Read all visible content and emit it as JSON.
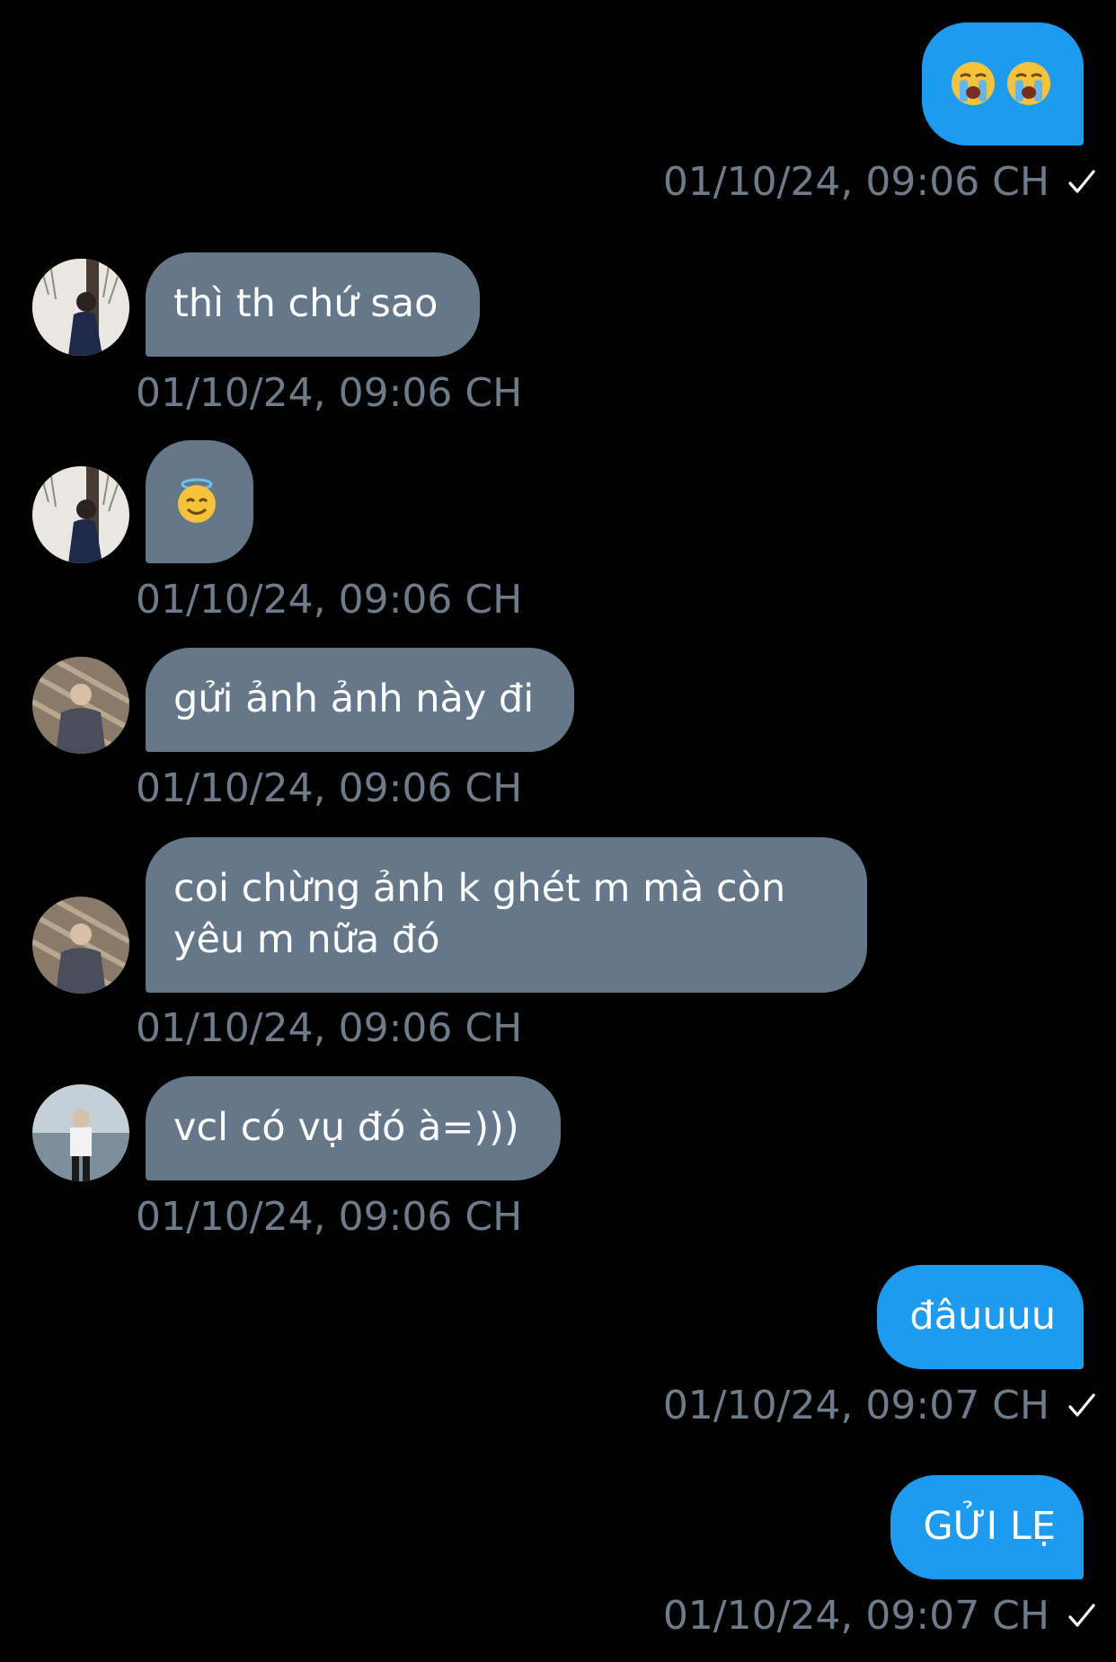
{
  "messages": [
    {
      "direction": "out",
      "emoji": [
        "loudly-crying-face-emoji",
        "loudly-crying-face-emoji"
      ],
      "timestamp": "01/10/24, 09:06 CH",
      "status_icon": "checkmark-icon"
    },
    {
      "direction": "in",
      "avatar": "avatar-a",
      "text": "thì th chứ sao",
      "timestamp": "01/10/24, 09:06 CH"
    },
    {
      "direction": "in",
      "avatar": "avatar-a",
      "emoji": [
        "smiling-face-with-halo-emoji"
      ],
      "timestamp": "01/10/24, 09:06 CH"
    },
    {
      "direction": "in",
      "avatar": "avatar-b",
      "text": "gửi ảnh ảnh này đi",
      "timestamp": "01/10/24, 09:06 CH"
    },
    {
      "direction": "in",
      "avatar": "avatar-b",
      "text_lines": [
        "coi chừng ảnh k ghét m mà còn",
        "yêu m nữa đó"
      ],
      "timestamp": "01/10/24, 09:06 CH"
    },
    {
      "direction": "in",
      "avatar": "avatar-c",
      "text": "vcl có vụ đó à=)))",
      "timestamp": "01/10/24, 09:06 CH"
    },
    {
      "direction": "out",
      "text": "đâuuuu",
      "timestamp": "01/10/24, 09:07 CH",
      "status_icon": "checkmark-icon"
    },
    {
      "direction": "out",
      "text": "GỬI LẸ",
      "timestamp": "01/10/24, 09:07 CH",
      "status_icon": "checkmark-icon"
    }
  ],
  "colors": {
    "background": "#000000",
    "outgoing_bubble": "#1d9bf0",
    "incoming_bubble": "#66778a",
    "timestamp_text": "#6e7b8a",
    "bubble_text": "#ffffff"
  }
}
